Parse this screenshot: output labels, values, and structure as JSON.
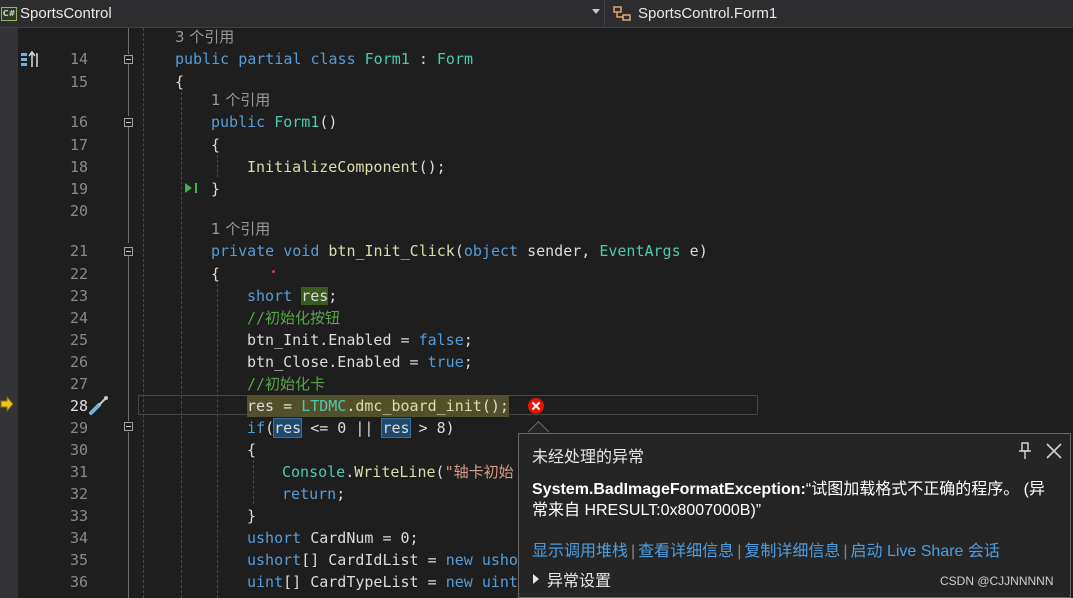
{
  "navbar": {
    "project_badge": "C#",
    "project": "SportsControl",
    "member": "SportsControl.Form1"
  },
  "editor": {
    "line_numbers": [
      "14",
      "15",
      "16",
      "17",
      "18",
      "19",
      "20",
      "21",
      "22",
      "23",
      "24",
      "25",
      "26",
      "27",
      "28",
      "29",
      "30",
      "31",
      "32",
      "33",
      "34",
      "35",
      "36"
    ],
    "current_line": "28",
    "ref_hints": [
      "3 个引用",
      "1 个引用",
      "1 个引用"
    ],
    "code": {
      "l14": [
        "public",
        "partial",
        "class",
        "Form1",
        ":",
        "Form"
      ],
      "l15": "{",
      "l16": [
        "public",
        "Form1",
        "()"
      ],
      "l17": "{",
      "l18": [
        "InitializeComponent",
        "();"
      ],
      "l19": "}",
      "l21": [
        "private",
        "void",
        "btn_Init_Click",
        "(",
        "object",
        "sender",
        "EventArgs",
        "e",
        ")"
      ],
      "l22": "{",
      "l23": [
        "short",
        "res",
        ";"
      ],
      "l24": "//初始化按钮",
      "l25": [
        "btn_Init",
        ".Enabled = ",
        "false",
        ";"
      ],
      "l26": [
        "btn_Close",
        ".Enabled = ",
        "true",
        ";"
      ],
      "l27": "//初始化卡",
      "l28": [
        "res",
        " = ",
        "LTDMC",
        ".",
        "dmc_board_init",
        "();"
      ],
      "l29": [
        "if",
        "(",
        "res",
        " <= 0 || ",
        "res",
        " > 8)"
      ],
      "l30": "{",
      "l31": [
        "Console",
        ".",
        "WriteLine",
        "(",
        "\"轴卡初始"
      ],
      "l32": [
        "return",
        ";"
      ],
      "l33": "}",
      "l34": [
        "ushort",
        "CardNum = 0;"
      ],
      "l35": [
        "ushort",
        "[] CardIdList = ",
        "new",
        "ushor"
      ],
      "l36": [
        "uint",
        "[] CardTypeList = ",
        "new",
        "uint"
      ]
    }
  },
  "exception_popup": {
    "title": "未经处理的异常",
    "exception_name": "System.BadImageFormatException:",
    "message": "“试图加载格式不正确的程序。 (异常来自 HRESULT:0x8007000B)”",
    "links": [
      "显示调用堆栈",
      "查看详细信息",
      "复制详细信息",
      "启动 Live Share 会话"
    ],
    "link_separator": "|",
    "settings_label": "异常设置"
  },
  "watermark": "CSDN @CJJNNNNN",
  "colors": {
    "background": "#1e1e1e",
    "keyword": "#569cd6",
    "type": "#4ec9b0",
    "method": "#dcdcaa",
    "comment": "#57a64a",
    "link": "#4d9de0",
    "error": "#e51400"
  }
}
